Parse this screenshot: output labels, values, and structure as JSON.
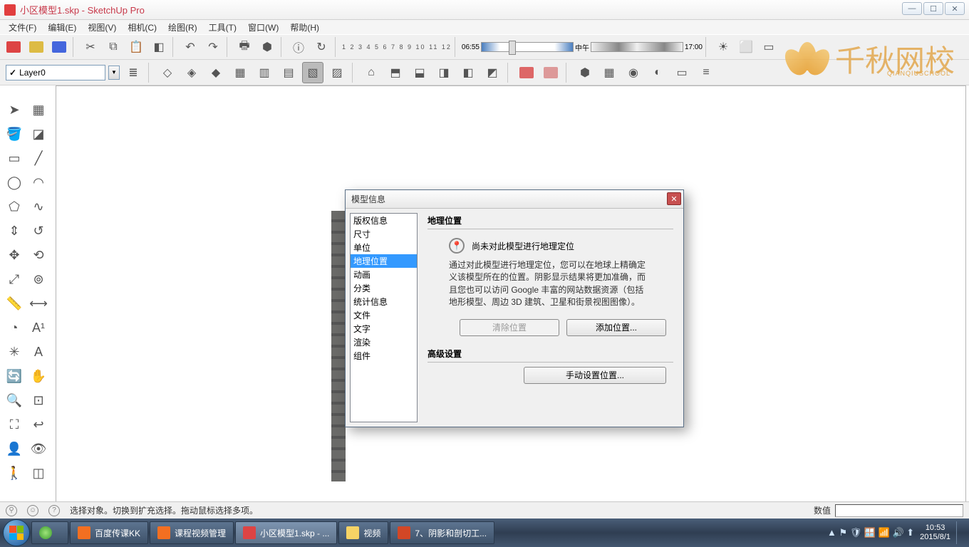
{
  "title": "小区模型1.skp - SketchUp Pro",
  "menu": [
    "文件(F)",
    "编辑(E)",
    "视图(V)",
    "相机(C)",
    "绘图(R)",
    "工具(T)",
    "窗口(W)",
    "帮助(H)"
  ],
  "layer": {
    "current": "Layer0"
  },
  "timebar": {
    "time_left": "06:55",
    "time_mid": "中午",
    "time_right": "17:00",
    "months": "1 2 3 4 5 6 7 8 9 10 11 12"
  },
  "watermark": {
    "text": "千秋网校",
    "sub": "QIANQIUSCHOOL"
  },
  "dialog": {
    "title": "模型信息",
    "categories": [
      "版权信息",
      "尺寸",
      "单位",
      "地理位置",
      "动画",
      "分类",
      "统计信息",
      "文件",
      "文字",
      "渲染",
      "组件"
    ],
    "selected_index": 3,
    "section_geo": "地理位置",
    "geo_notice": "尚未对此模型进行地理定位",
    "geo_desc": "通过对此模型进行地理定位，您可以在地球上精确定义该模型所在的位置。阴影显示结果将更加准确，而且您也可以访问 Google 丰富的网站数据资源（包括地形模型、周边 3D 建筑、卫星和街景视图图像）。",
    "btn_clear": "清除位置",
    "btn_add": "添加位置...",
    "section_adv": "高级设置",
    "btn_manual": "手动设置位置..."
  },
  "status": {
    "hint": "选择对象。切换到扩充选择。拖动鼠标选择多项。",
    "value_label": "数值"
  },
  "taskbar": {
    "items": [
      {
        "label": "",
        "color": "#6fc24a"
      },
      {
        "label": "百度传课KK",
        "color": "#f36f21"
      },
      {
        "label": "课程视频管理",
        "color": "#f36f21"
      },
      {
        "label": "小区模型1.skp - ...",
        "color": "#d44",
        "active": true
      },
      {
        "label": "视频",
        "color": "#f6d365"
      },
      {
        "label": "7、阴影和剖切工...",
        "color": "#d24726"
      }
    ],
    "clock_time": "10:53",
    "clock_date": "2015/8/1"
  }
}
